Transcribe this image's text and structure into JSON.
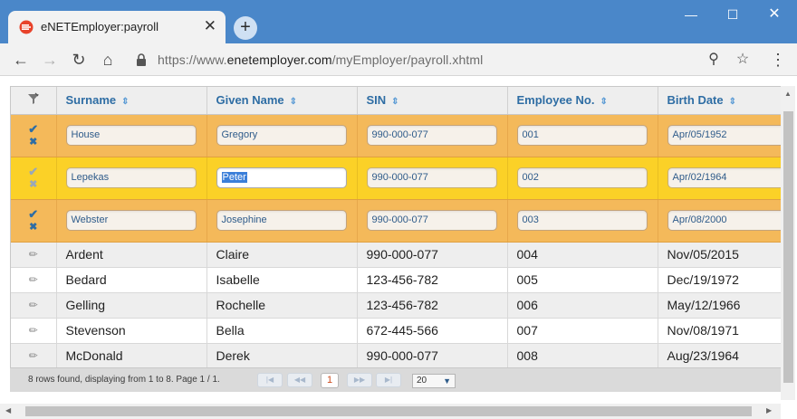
{
  "browser": {
    "tab_title": "eNETEmployer:payroll",
    "tab_close": "✕",
    "new_tab": "+",
    "url_prefix": "https://www.",
    "url_domain": "enetemployer.com",
    "url_path": "/myEmployer/payroll.xhtml"
  },
  "table": {
    "columns": [
      "Surname",
      "Given Name",
      "SIN",
      "Employee No.",
      "Birth Date"
    ],
    "edit_rows": [
      {
        "surname": "House",
        "given": "Gregory",
        "sin": "990-000-077",
        "emp_no": "001",
        "birth": "Apr/05/1952"
      },
      {
        "surname": "Lepekas",
        "given": "Peter",
        "sin": "990-000-077",
        "emp_no": "002",
        "birth": "Apr/02/1964"
      },
      {
        "surname": "Webster",
        "given": "Josephine",
        "sin": "990-000-077",
        "emp_no": "003",
        "birth": "Apr/08/2000"
      }
    ],
    "rows": [
      {
        "surname": "Ardent",
        "given": "Claire",
        "sin": "990-000-077",
        "emp_no": "004",
        "birth": "Nov/05/2015"
      },
      {
        "surname": "Bedard",
        "given": "Isabelle",
        "sin": "123-456-782",
        "emp_no": "005",
        "birth": "Dec/19/1972"
      },
      {
        "surname": "Gelling",
        "given": "Rochelle",
        "sin": "123-456-782",
        "emp_no": "006",
        "birth": "May/12/1966"
      },
      {
        "surname": "Stevenson",
        "given": "Bella",
        "sin": "672-445-566",
        "emp_no": "007",
        "birth": "Nov/08/1971"
      },
      {
        "surname": "McDonald",
        "given": "Derek",
        "sin": "990-000-077",
        "emp_no": "008",
        "birth": "Aug/23/1964"
      }
    ]
  },
  "pager": {
    "summary": "8 rows found, displaying from 1 to 8. Page 1 / 1.",
    "current_page": "1",
    "rows_per_page": "20"
  },
  "colors": {
    "header_blue": "#4a87c9",
    "edit_row": "#f4b95a",
    "active_row": "#fbd127",
    "link_blue": "#2e6da4"
  }
}
